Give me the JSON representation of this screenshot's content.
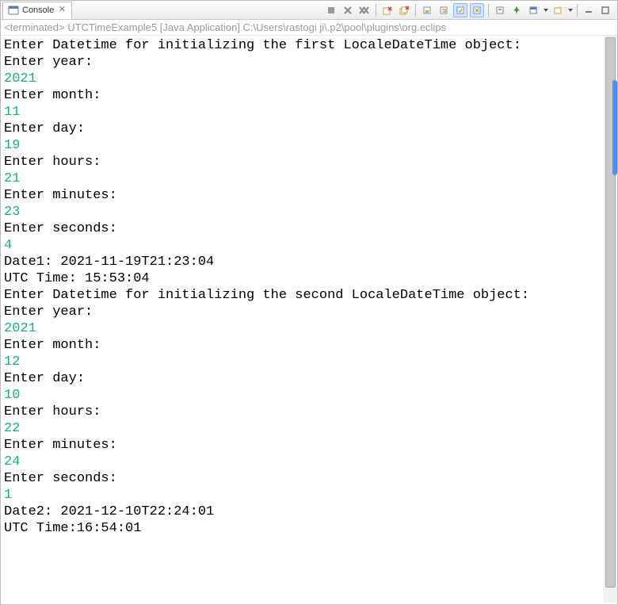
{
  "tab": {
    "title": "Console"
  },
  "status": "<terminated> UTCTimeExample5 [Java Application] C:\\Users\\rastogi ji\\.p2\\pool\\plugins\\org.eclips",
  "toolbar": {
    "icons": [
      "stop-icon",
      "terminate-icon",
      "terminate-all-icon",
      "remove-launch-icon",
      "remove-all-icon",
      "scroll-lock-icon",
      "word-wrap-icon",
      "show-on-out-icon",
      "show-on-err-icon",
      "clear-icon",
      "pin-icon",
      "display-selected-icon",
      "open-console-icon",
      "minimize-icon",
      "maximize-icon"
    ]
  },
  "console": {
    "lines": [
      {
        "t": "p",
        "v": "Enter Datetime for initializing the first LocaleDateTime object:"
      },
      {
        "t": "p",
        "v": "Enter year:"
      },
      {
        "t": "i",
        "v": "2021"
      },
      {
        "t": "p",
        "v": "Enter month:"
      },
      {
        "t": "i",
        "v": "11"
      },
      {
        "t": "p",
        "v": "Enter day:"
      },
      {
        "t": "i",
        "v": "19"
      },
      {
        "t": "p",
        "v": "Enter hours:"
      },
      {
        "t": "i",
        "v": "21"
      },
      {
        "t": "p",
        "v": "Enter minutes:"
      },
      {
        "t": "i",
        "v": "23"
      },
      {
        "t": "p",
        "v": "Enter seconds:"
      },
      {
        "t": "i",
        "v": "4"
      },
      {
        "t": "p",
        "v": "Date1: 2021-11-19T21:23:04"
      },
      {
        "t": "p",
        "v": "UTC Time: 15:53:04"
      },
      {
        "t": "p",
        "v": "Enter Datetime for initializing the second LocaleDateTime object:"
      },
      {
        "t": "p",
        "v": "Enter year:"
      },
      {
        "t": "i",
        "v": "2021"
      },
      {
        "t": "p",
        "v": "Enter month:"
      },
      {
        "t": "i",
        "v": "12"
      },
      {
        "t": "p",
        "v": "Enter day:"
      },
      {
        "t": "i",
        "v": "10"
      },
      {
        "t": "p",
        "v": "Enter hours:"
      },
      {
        "t": "i",
        "v": "22"
      },
      {
        "t": "p",
        "v": "Enter minutes:"
      },
      {
        "t": "i",
        "v": "24"
      },
      {
        "t": "p",
        "v": "Enter seconds:"
      },
      {
        "t": "i",
        "v": "1"
      },
      {
        "t": "p",
        "v": "Date2: 2021-12-10T22:24:01"
      },
      {
        "t": "p",
        "v": "UTC Time:16:54:01"
      }
    ]
  }
}
